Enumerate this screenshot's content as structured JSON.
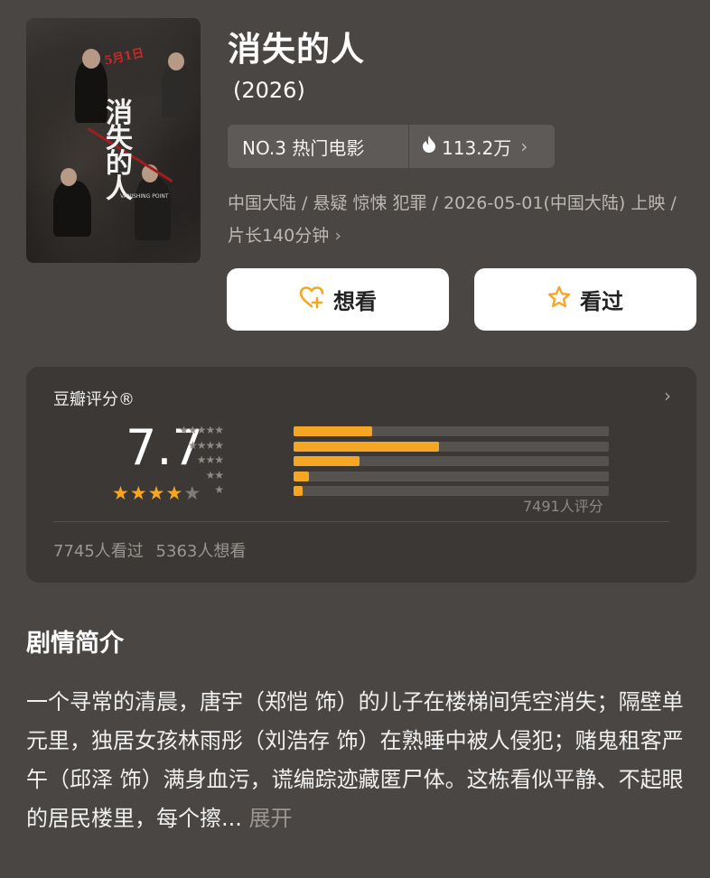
{
  "movie": {
    "title": "消失的人",
    "year": "(2026)",
    "rank_label": "NO.3 热门电影",
    "heat_value": "113.2万",
    "meta_line": "中国大陆 / 悬疑 惊悚 犯罪 / 2026-05-01(中国大陆) 上映 / 片长140分钟",
    "poster": {
      "date_text": "5月1日",
      "title_text": "消失的人",
      "subtitle_text": "VANISHING POINT"
    }
  },
  "actions": {
    "want_label": "想看",
    "seen_label": "看过"
  },
  "rating": {
    "title": "豆瓣评分®",
    "score": "7.7",
    "stars": {
      "filled": 4,
      "total": 5
    },
    "distribution": [
      {
        "stars": 5,
        "fraction": 0.25
      },
      {
        "stars": 4,
        "fraction": 0.46
      },
      {
        "stars": 3,
        "fraction": 0.21
      },
      {
        "stars": 2,
        "fraction": 0.05
      },
      {
        "stars": 1,
        "fraction": 0.03
      }
    ],
    "count_text": "7491人评分",
    "seen_count": "7745人看过",
    "want_count": "5363人想看"
  },
  "synopsis": {
    "heading": "剧情简介",
    "text": "一个寻常的清晨，唐宇（郑恺 饰）的儿子在楼梯间凭空消失；隔壁单元里，独居女孩林雨彤（刘浩存 饰）在熟睡中被人侵犯；赌鬼租客严午（邱泽 饰）满身血污，谎编踪迹藏匿尸体。这栋看似平静、不起眼的居民楼里，每个擦...",
    "expand_label": "展开"
  },
  "colors": {
    "background": "#4a4643",
    "card": "#3b3836",
    "accent": "#f5a623"
  }
}
